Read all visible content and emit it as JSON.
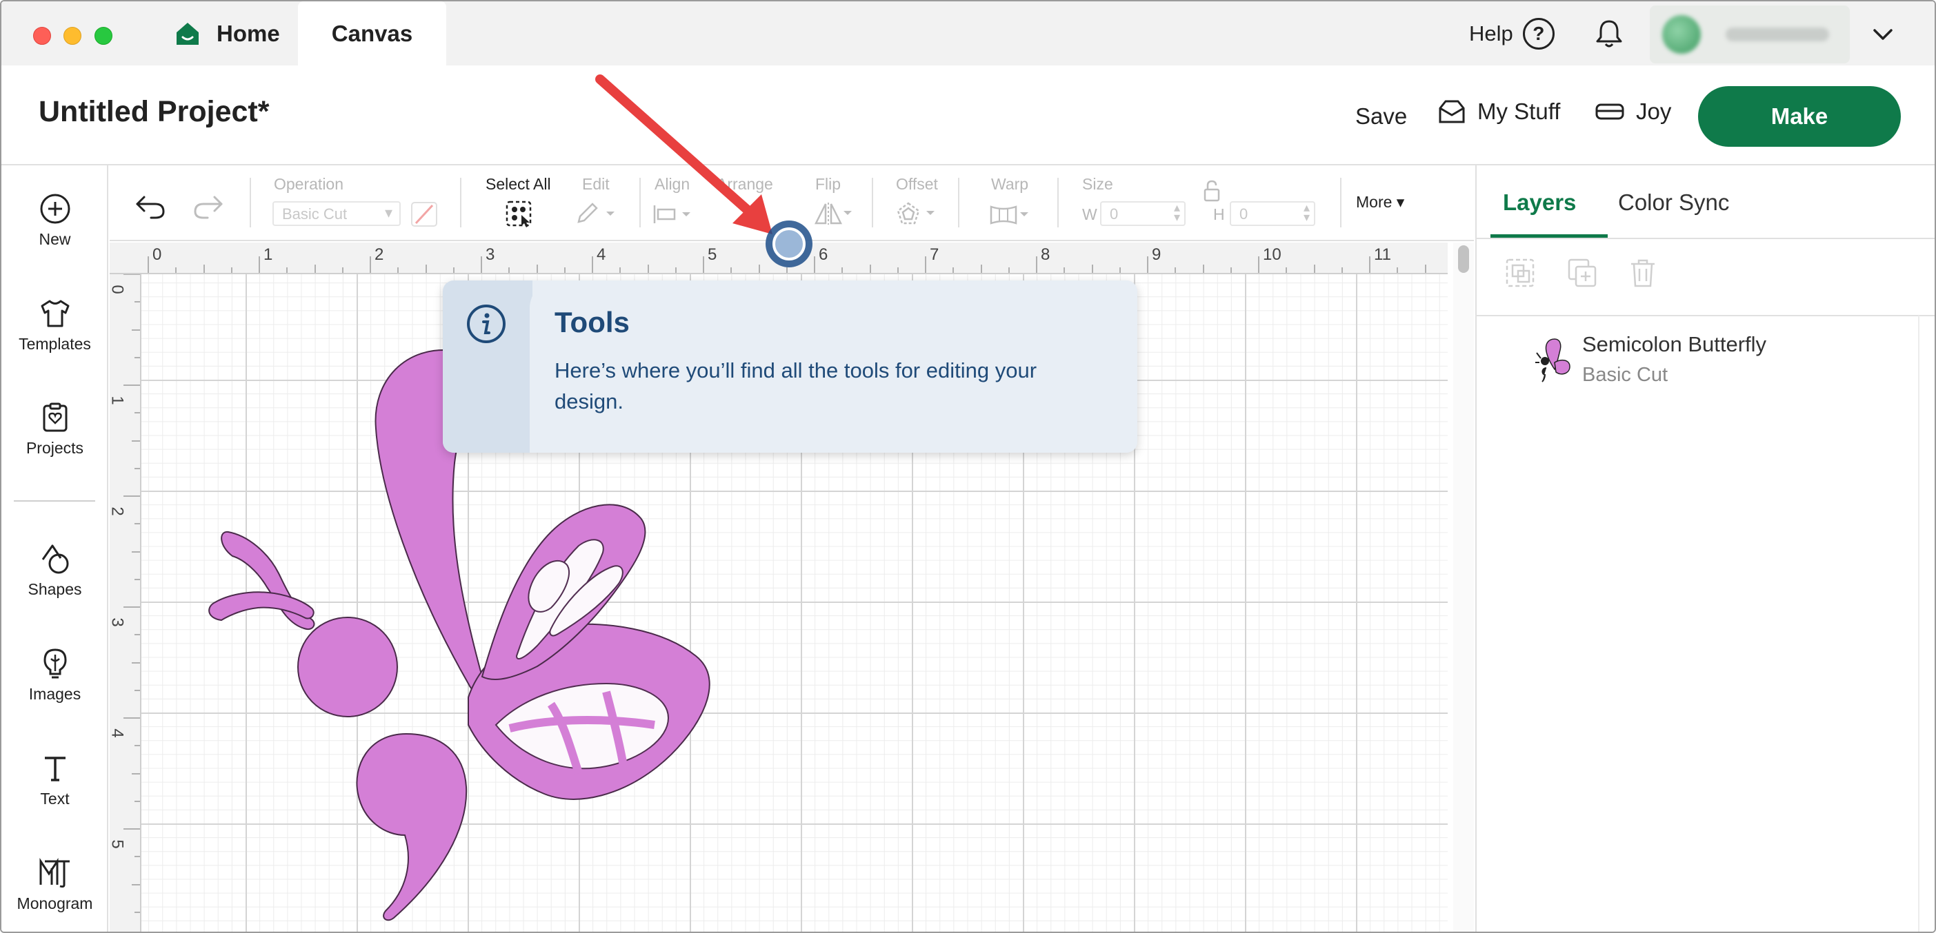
{
  "titlebar": {
    "tabs": [
      {
        "label": "Home"
      },
      {
        "label": "Canvas"
      }
    ],
    "help_label": "Help"
  },
  "header": {
    "project_title": "Untitled Project*",
    "save_label": "Save",
    "mystuff_label": "My Stuff",
    "joy_label": "Joy",
    "make_label": "Make"
  },
  "sidebar": {
    "items": [
      {
        "label": "New",
        "icon": "plus-circle-icon"
      },
      {
        "label": "Templates",
        "icon": "tshirt-icon"
      },
      {
        "label": "Projects",
        "icon": "clipboard-heart-icon"
      },
      {
        "label": "Shapes",
        "icon": "shapes-icon"
      },
      {
        "label": "Images",
        "icon": "lightbulb-icon"
      },
      {
        "label": "Text",
        "icon": "text-icon"
      },
      {
        "label": "Monogram",
        "icon": "monogram-icon"
      }
    ]
  },
  "toolbar": {
    "operation_label": "Operation",
    "operation_value": "Basic Cut",
    "select_all_label": "Select All",
    "edit_label": "Edit",
    "align_label": "Align",
    "arrange_label": "Arrange",
    "flip_label": "Flip",
    "offset_label": "Offset",
    "warp_label": "Warp",
    "size_label": "Size",
    "w_label": "W",
    "w_value": "0",
    "h_label": "H",
    "h_value": "0",
    "more_label": "More"
  },
  "ruler": {
    "top_ticks": [
      "0",
      "1",
      "2",
      "3",
      "4",
      "5",
      "6",
      "7",
      "8",
      "9",
      "10",
      "11"
    ],
    "left_ticks": [
      "0",
      "1",
      "2",
      "3",
      "4",
      "5"
    ]
  },
  "tooltip": {
    "title": "Tools",
    "text": "Here’s where you’ll find all the tools for editing your design."
  },
  "right_panel": {
    "tabs": [
      {
        "label": "Layers",
        "active": true
      },
      {
        "label": "Color Sync",
        "active": false
      }
    ],
    "layers": [
      {
        "name": "Semicolon Butterfly",
        "operation": "Basic Cut"
      }
    ]
  },
  "colors": {
    "brand_green": "#0f7a4a",
    "butterfly_fill": "#d47fd6",
    "tooltip_text": "#1f4a78",
    "annotation_arrow": "#e8403f"
  }
}
